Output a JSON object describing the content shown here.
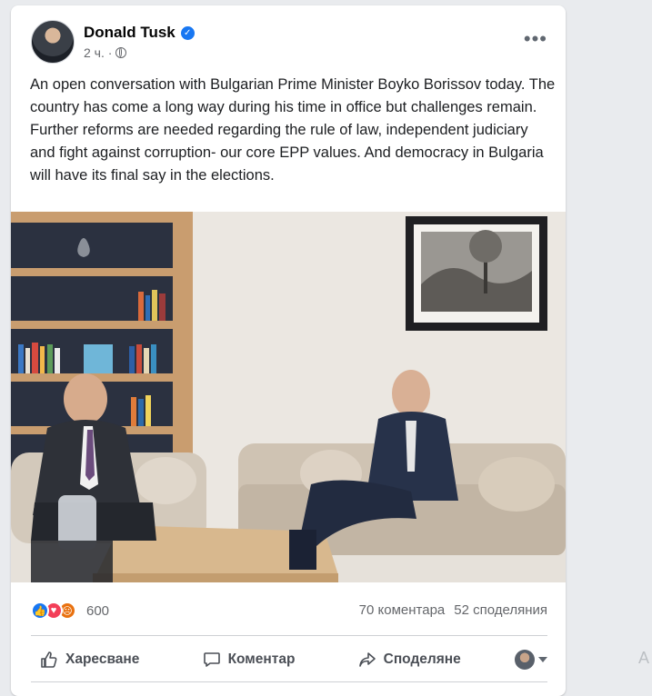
{
  "post": {
    "author": "Donald Tusk",
    "time": "2 ч. ·",
    "text": "An open conversation with Bulgarian Prime Minister Boyko Borissov today. The country has come a long way during his time in office but challenges remain. Further reforms are needed regarding the rule of law, independent judiciary and fight against corruption- our core EPP values. And democracy in Bulgaria will have its final say in the elections."
  },
  "stats": {
    "reactions_count": "600",
    "comments": "70 коментара",
    "shares": "52 споделяния"
  },
  "actions": {
    "like": "Харесване",
    "comment": "Коментар",
    "share": "Споделяне"
  },
  "edge_letter": "A",
  "colors": {
    "accent": "#1877f2",
    "love": "#f33e58",
    "angry": "#e9710f",
    "text_secondary": "#65676b"
  },
  "icons": {
    "verified": "verified-badge-icon",
    "audience": "globe-icon",
    "more": "more-options-icon",
    "like": "thumbs-up-icon",
    "comment": "comment-bubble-icon",
    "share": "share-arrow-icon"
  }
}
